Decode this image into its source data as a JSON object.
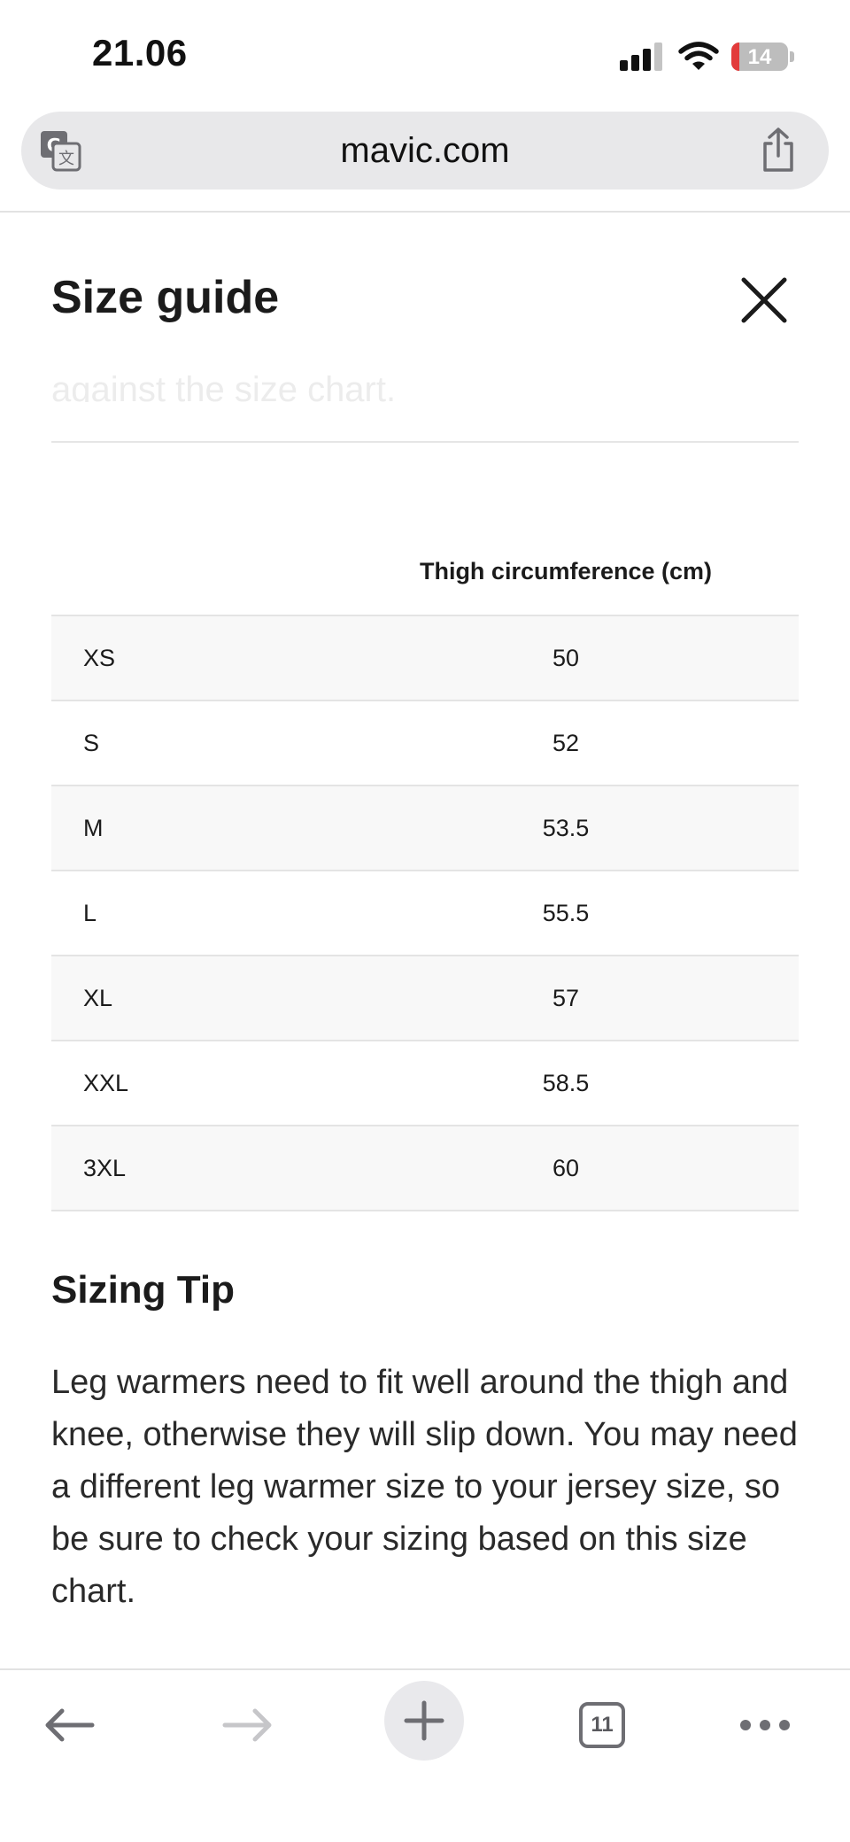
{
  "status_bar": {
    "time": "21.06",
    "battery_level": "14",
    "battery_color": "#e23b3b"
  },
  "browser": {
    "url": "mavic.com",
    "translate_icon": "translate-icon",
    "share_icon": "share-icon"
  },
  "modal": {
    "title": "Size guide",
    "close_icon": "close-icon",
    "faded_text": "against the size chart.",
    "table": {
      "header": "Thigh circumference (cm)",
      "rows": [
        {
          "size": "XS",
          "value": "50"
        },
        {
          "size": "S",
          "value": "52"
        },
        {
          "size": "M",
          "value": "53.5"
        },
        {
          "size": "L",
          "value": "55.5"
        },
        {
          "size": "XL",
          "value": "57"
        },
        {
          "size": "XXL",
          "value": "58.5"
        },
        {
          "size": "3XL",
          "value": "60"
        }
      ]
    },
    "tip_title": "Sizing Tip",
    "tip_body": "Leg warmers need to fit well around the thigh and knee, otherwise they will slip down. You may need a different leg warmer size to your jersey size, so be sure to check your sizing based on this size chart."
  },
  "toolbar": {
    "tab_count": "11",
    "icons": [
      "back-arrow-icon",
      "forward-arrow-icon",
      "plus-icon",
      "tabs-icon",
      "more-icon"
    ]
  }
}
